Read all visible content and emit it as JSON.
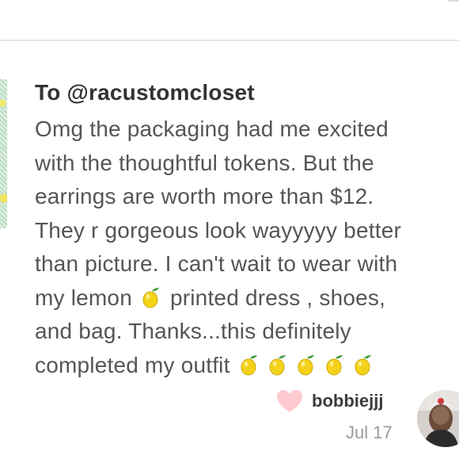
{
  "note": {
    "recipient": "To @racustomcloset",
    "lines": [
      [
        "Omg the packaging had me excited"
      ],
      [
        "with the thoughtful tokens. But the"
      ],
      [
        "earrings are worth more than $12."
      ],
      [
        "They r gorgeous look wayyyyy better"
      ],
      [
        "than picture. I can't wait to wear with"
      ],
      [
        "my lemon",
        "printed dress , shoes,"
      ],
      [
        "and bag. Thanks...this definitely"
      ],
      [
        "completed my outfit"
      ]
    ],
    "emoji": "lemon-icon"
  },
  "author": {
    "username": "bobbiejjj",
    "date": "Jul 17",
    "like_icon": "heart-icon"
  },
  "colors": {
    "heart": "#ffc9d0",
    "date": "#9a9a9a",
    "username": "#3c3c3c",
    "text": "#555555",
    "lemon": "#f5d21a"
  }
}
